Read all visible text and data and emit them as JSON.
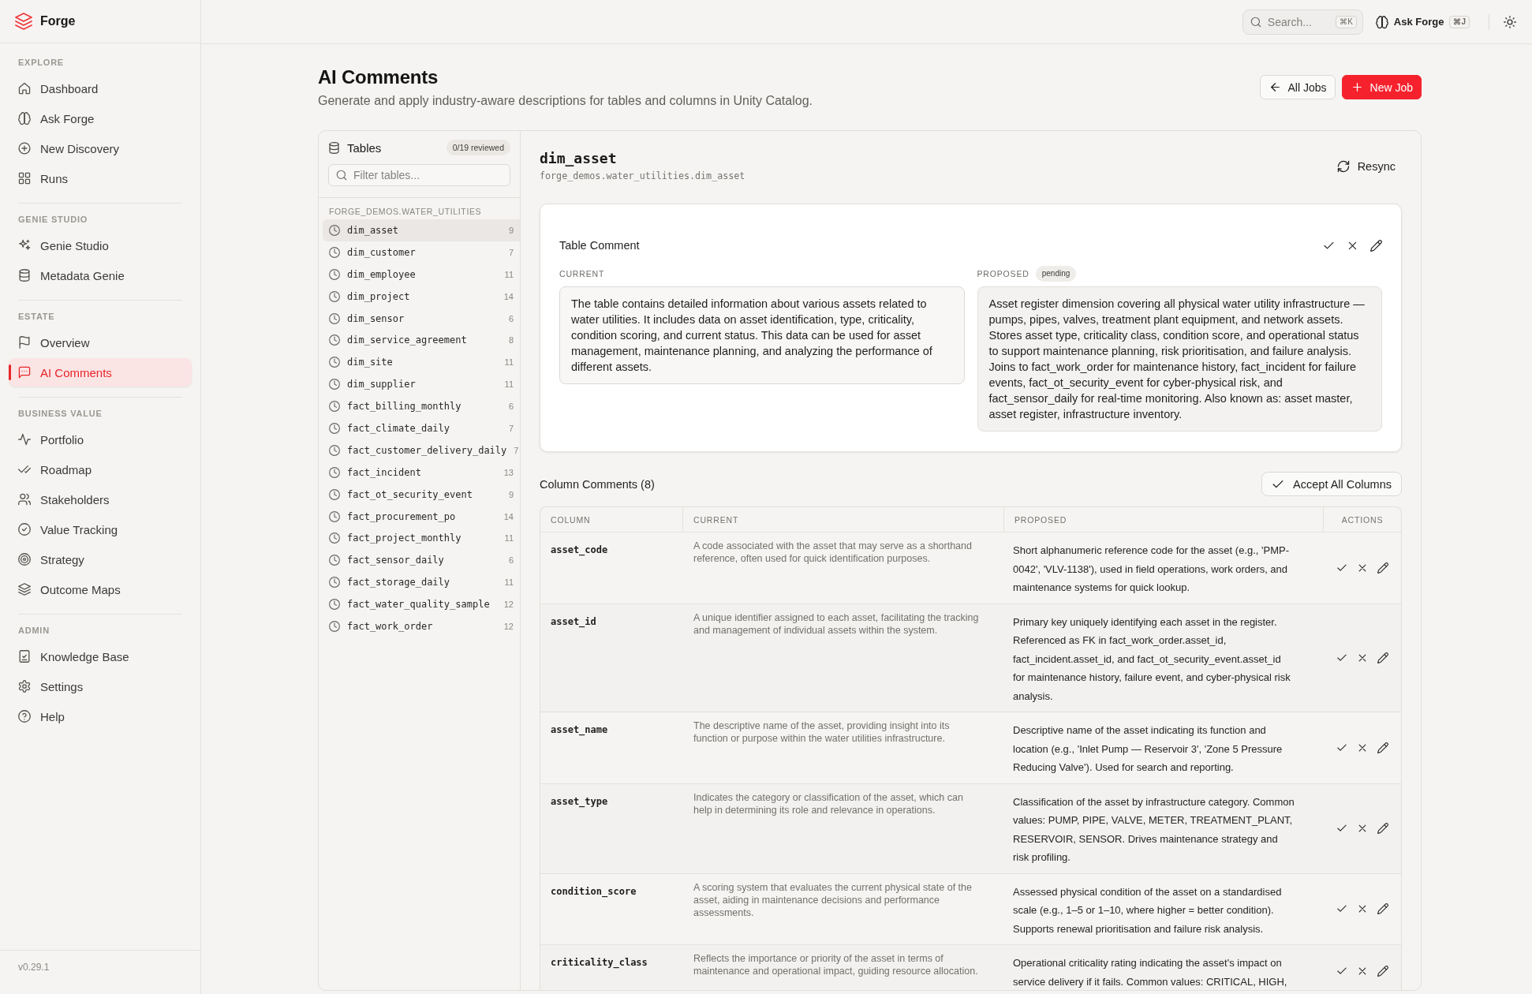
{
  "app": {
    "name": "Forge",
    "version": "v0.29.1"
  },
  "sidebar": {
    "sections": [
      {
        "title": "EXPLORE",
        "items": [
          {
            "label": "Dashboard",
            "selected": false
          },
          {
            "label": "Ask Forge",
            "selected": false
          },
          {
            "label": "New Discovery",
            "selected": false
          },
          {
            "label": "Runs",
            "selected": false
          }
        ]
      },
      {
        "title": "GENIE STUDIO",
        "items": [
          {
            "label": "Genie Studio",
            "selected": false
          },
          {
            "label": "Metadata Genie",
            "selected": false
          }
        ]
      },
      {
        "title": "ESTATE",
        "items": [
          {
            "label": "Overview",
            "selected": false
          },
          {
            "label": "AI Comments",
            "selected": true
          }
        ]
      },
      {
        "title": "BUSINESS VALUE",
        "items": [
          {
            "label": "Portfolio",
            "selected": false
          },
          {
            "label": "Roadmap",
            "selected": false
          },
          {
            "label": "Stakeholders",
            "selected": false
          },
          {
            "label": "Value Tracking",
            "selected": false
          },
          {
            "label": "Strategy",
            "selected": false
          },
          {
            "label": "Outcome Maps",
            "selected": false
          }
        ]
      },
      {
        "title": "ADMIN",
        "items": [
          {
            "label": "Knowledge Base",
            "selected": false
          },
          {
            "label": "Settings",
            "selected": false
          },
          {
            "label": "Help",
            "selected": false
          }
        ]
      }
    ]
  },
  "top_bar": {
    "search": {
      "placeholder": "Search...",
      "shortcut": "⌘K"
    },
    "ask_button": {
      "label": "Ask Forge",
      "shortcut": "⌘J"
    }
  },
  "page": {
    "title": "AI Comments",
    "subtitle": "Generate and apply industry-aware descriptions for tables and columns in Unity Catalog.",
    "buttons": [
      {
        "label": "All Jobs",
        "kind": "secondary"
      },
      {
        "label": "New Job",
        "kind": "primary"
      }
    ]
  },
  "tables_panel": {
    "title": "Tables",
    "badge": "0/19 reviewed",
    "filter": {
      "placeholder": "Filter tables..."
    },
    "schema": "FORGE_DEMOS.WATER_UTILITIES",
    "items": [
      {
        "name": "dim_asset",
        "count": "9",
        "selected": true
      },
      {
        "name": "dim_customer",
        "count": "7",
        "selected": false
      },
      {
        "name": "dim_employee",
        "count": "11",
        "selected": false
      },
      {
        "name": "dim_project",
        "count": "14",
        "selected": false
      },
      {
        "name": "dim_sensor",
        "count": "6",
        "selected": false
      },
      {
        "name": "dim_service_agreement",
        "count": "8",
        "selected": false
      },
      {
        "name": "dim_site",
        "count": "11",
        "selected": false
      },
      {
        "name": "dim_supplier",
        "count": "11",
        "selected": false
      },
      {
        "name": "fact_billing_monthly",
        "count": "6",
        "selected": false
      },
      {
        "name": "fact_climate_daily",
        "count": "7",
        "selected": false
      },
      {
        "name": "fact_customer_delivery_daily",
        "count": "7",
        "selected": false
      },
      {
        "name": "fact_incident",
        "count": "13",
        "selected": false
      },
      {
        "name": "fact_ot_security_event",
        "count": "9",
        "selected": false
      },
      {
        "name": "fact_procurement_po",
        "count": "14",
        "selected": false
      },
      {
        "name": "fact_project_monthly",
        "count": "11",
        "selected": false
      },
      {
        "name": "fact_sensor_daily",
        "count": "6",
        "selected": false
      },
      {
        "name": "fact_storage_daily",
        "count": "11",
        "selected": false
      },
      {
        "name": "fact_water_quality_sample",
        "count": "12",
        "selected": false
      },
      {
        "name": "fact_work_order",
        "count": "12",
        "selected": false
      }
    ]
  },
  "detail": {
    "table_name": "dim_asset",
    "path": "forge_demos.water_utilities.dim_asset",
    "resync_button": "Resync",
    "table_comment": {
      "title": "Table Comment",
      "current_label": "CURRENT",
      "current": "The table contains detailed information about various assets related to water utilities. It includes data on asset identification, type, criticality, condition scoring, and current status. This data can be used for asset management, maintenance planning, and analyzing the performance of different assets.",
      "proposed_label": "PROPOSED",
      "status": "pending",
      "proposed": "Asset register dimension covering all physical water utility infrastructure — pumps, pipes, valves, treatment plant equipment, and network assets. Stores asset type, criticality class, condition score, and operational status to support maintenance planning, risk prioritisation, and failure analysis. Joins to fact_work_order for maintenance history, fact_incident for failure events, fact_ot_security_event for cyber-physical risk, and fact_sensor_daily for real-time monitoring. Also known as: asset master, asset register, infrastructure inventory."
    },
    "column_comments": {
      "title": "Column Comments (8)",
      "accept_all_button": "Accept All Columns",
      "columns": [
        "COLUMN",
        "CURRENT",
        "PROPOSED",
        "ACTIONS"
      ],
      "rows": [
        {
          "column": "asset_code",
          "current": "A code associated with the asset that may serve as a shorthand reference, often used for quick identification purposes.",
          "proposed": "Short alphanumeric reference code for the asset (e.g., 'PMP-0042', 'VLV-1138'), used in field operations, work orders, and maintenance systems for quick lookup."
        },
        {
          "column": "asset_id",
          "current": "A unique identifier assigned to each asset, facilitating the tracking and management of individual assets within the system.",
          "proposed": "Primary key uniquely identifying each asset in the register. Referenced as FK in fact_work_order.asset_id, fact_incident.asset_id, and fact_ot_security_event.asset_id for maintenance history, failure event, and cyber-physical risk analysis."
        },
        {
          "column": "asset_name",
          "current": "The descriptive name of the asset, providing insight into its function or purpose within the water utilities infrastructure.",
          "proposed": "Descriptive name of the asset indicating its function and location (e.g., 'Inlet Pump — Reservoir 3', 'Zone 5 Pressure Reducing Valve'). Used for search and reporting."
        },
        {
          "column": "asset_type",
          "current": "Indicates the category or classification of the asset, which can help in determining its role and relevance in operations.",
          "proposed": "Classification of the asset by infrastructure category. Common values: PUMP, PIPE, VALVE, METER, TREATMENT_PLANT, RESERVOIR, SENSOR. Drives maintenance strategy and risk profiling."
        },
        {
          "column": "condition_score",
          "current": "A scoring system that evaluates the current physical state of the asset, aiding in maintenance decisions and performance assessments.",
          "proposed": "Assessed physical condition of the asset on a standardised scale (e.g., 1–5 or 1–10, where higher = better condition). Supports renewal prioritisation and failure risk analysis."
        },
        {
          "column": "criticality_class",
          "current": "Reflects the importance or priority of the asset in terms of maintenance and operational impact, guiding resource allocation.",
          "proposed": "Operational criticality rating indicating the asset's impact on service delivery if it fails. Common values: CRITICAL, HIGH,"
        }
      ]
    }
  }
}
